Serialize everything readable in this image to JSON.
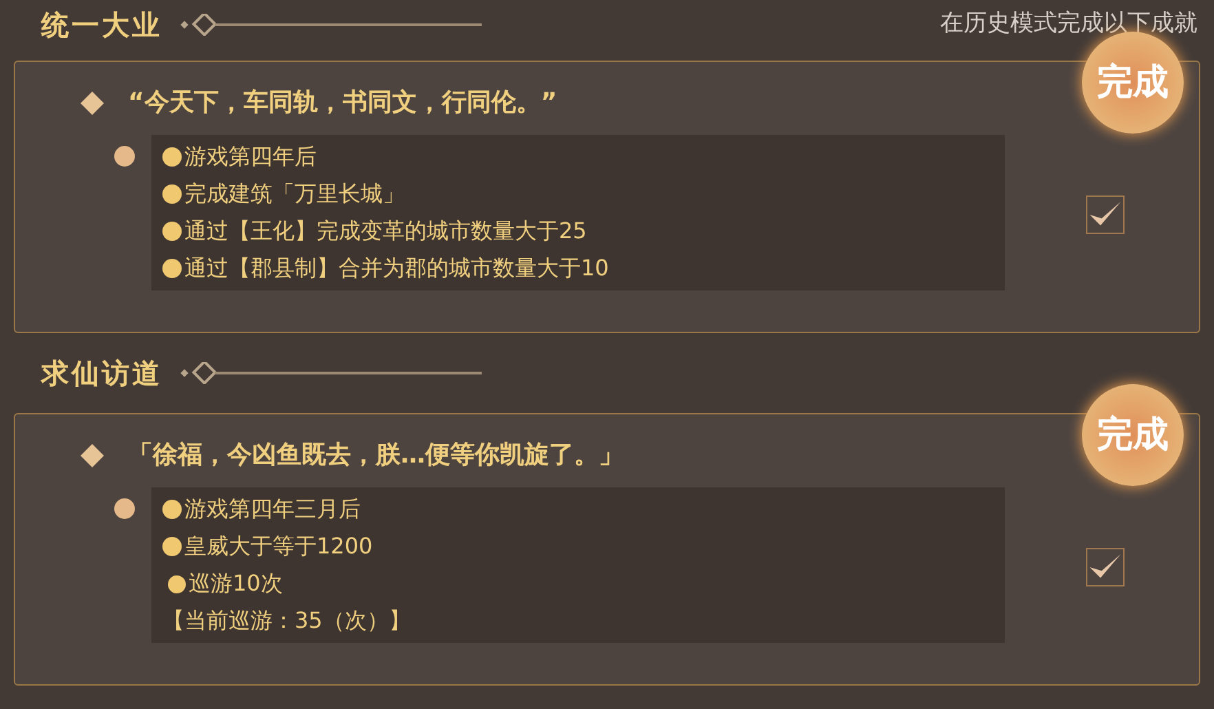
{
  "subtitle": "在历史模式完成以下成就",
  "achievements": [
    {
      "title": "统一大业",
      "quote": "“今天下，车同轨，书同文，行同伦。”",
      "stamp": "完成",
      "completed": true,
      "checked": true,
      "conditions": [
        {
          "kind": "condition",
          "text": "游戏第四年后"
        },
        {
          "kind": "condition",
          "text": "完成建筑「万里长城」"
        },
        {
          "kind": "condition",
          "text": "通过【王化】完成变革的城市数量大于25"
        },
        {
          "kind": "condition",
          "text": "通过【郡县制】合并为郡的城市数量大于10"
        }
      ]
    },
    {
      "title": "求仙访道",
      "quote": "「徐福，今凶鱼既去，朕…便等你凯旋了。」",
      "stamp": "完成",
      "completed": true,
      "checked": true,
      "conditions": [
        {
          "kind": "condition",
          "text": "游戏第四年三月后"
        },
        {
          "kind": "condition",
          "text": "皇威大于等于1200"
        },
        {
          "kind": "sub",
          "text": "巡游10次"
        },
        {
          "kind": "progress",
          "text": "【当前巡游：35（次）】"
        }
      ]
    }
  ]
}
